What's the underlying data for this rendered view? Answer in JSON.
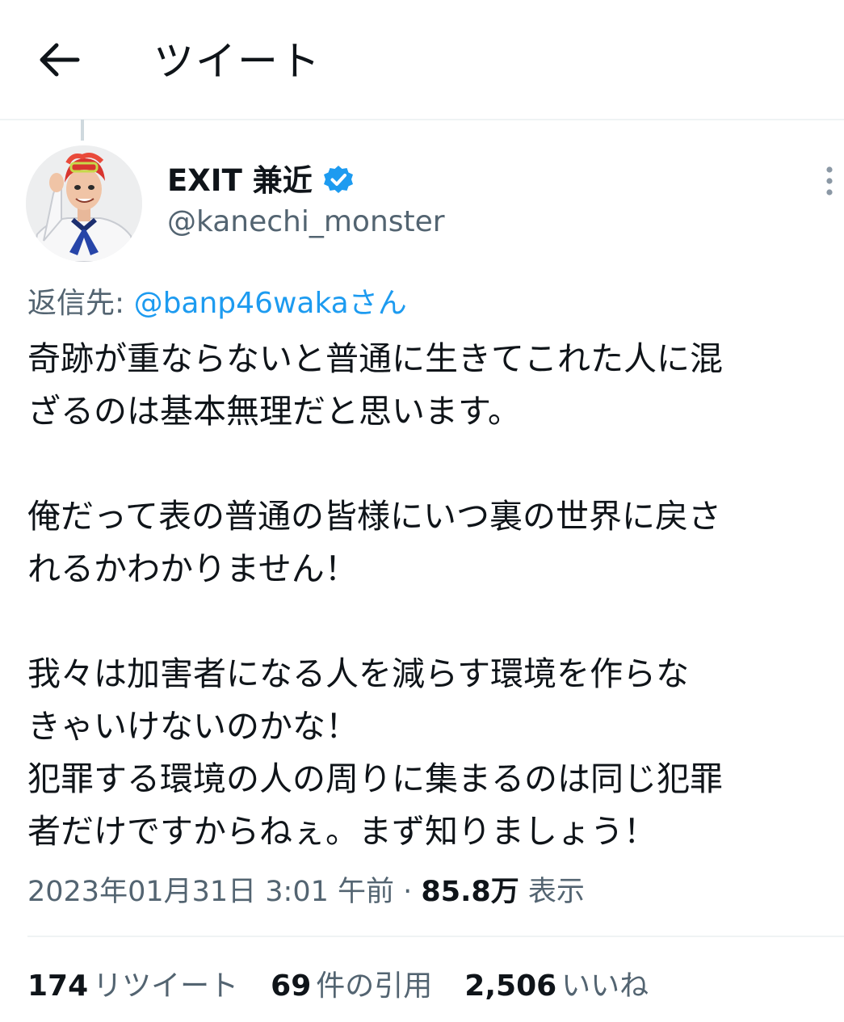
{
  "header": {
    "title": "ツイート",
    "back_icon": "arrow-left-icon"
  },
  "tweet": {
    "author": {
      "display_name": "EXIT 兼近",
      "handle": "@kanechi_monster",
      "verified": true,
      "verified_color": "#1d9bf0"
    },
    "reply_to": {
      "prefix": "返信先: ",
      "user": "@banp46wakaさん"
    },
    "text_lines": [
      "奇跡が重ならないと普通に生きてこれた人に混",
      "ざるのは基本無理だと思います。",
      "",
      "俺だって表の普通の皆様にいつ裏の世界に戻さ",
      "れるかわかりません！",
      "",
      "我々は加害者になる人を減らす環境を作らな",
      "きゃいけないのかな！",
      "犯罪する環境の人の周りに集まるのは同じ犯罪",
      "者だけですからねぇ。まず知りましょう！"
    ],
    "timestamp": "2023年01月31日 3:01 午前",
    "separator": " · ",
    "views_count": "85.8万",
    "views_label": " 表示"
  },
  "stats": {
    "retweets": {
      "count": "174",
      "label": "リツイート"
    },
    "quotes": {
      "count": "69",
      "label": "件の引用"
    },
    "likes": {
      "count": "2,506",
      "label": "いいね"
    }
  },
  "colors": {
    "link": "#1d9bf0",
    "secondary_text": "#536471",
    "primary_text": "#0f1419",
    "divider": "#eff3f4"
  }
}
